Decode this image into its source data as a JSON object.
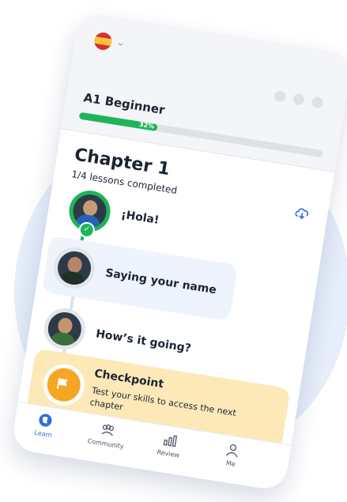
{
  "header": {
    "language_flag_icon": "spain-flag-icon",
    "chevron_icon": "chevron-down-icon"
  },
  "course": {
    "level": "A1 Beginner",
    "progress_percent": 32,
    "progress_label": "32%"
  },
  "chapter": {
    "title": "Chapter 1",
    "subtitle": "1/4 lessons completed",
    "download_icon": "cloud-download-icon"
  },
  "lessons": [
    {
      "title": "¡Hola!",
      "completed": true
    },
    {
      "title": "Saying your name",
      "completed": false,
      "current": true
    },
    {
      "title": "How’s it going?",
      "completed": false
    }
  ],
  "checkpoint": {
    "title": "Checkpoint",
    "description": "Test your skills to access the next chapter",
    "icon": "flag-icon"
  },
  "nav": {
    "items": [
      {
        "label": "Learn",
        "icon": "globe-icon",
        "active": true
      },
      {
        "label": "Community",
        "icon": "community-icon",
        "active": false
      },
      {
        "label": "Review",
        "icon": "review-icon",
        "active": false
      },
      {
        "label": "Me",
        "icon": "profile-icon",
        "active": false
      }
    ]
  },
  "colors": {
    "accent_green": "#1fb45a",
    "accent_blue": "#2c6ce8",
    "checkpoint_bg": "#fde9b8",
    "checkpoint_badge": "#f6a623",
    "current_lesson_bg": "#eef3fc"
  }
}
